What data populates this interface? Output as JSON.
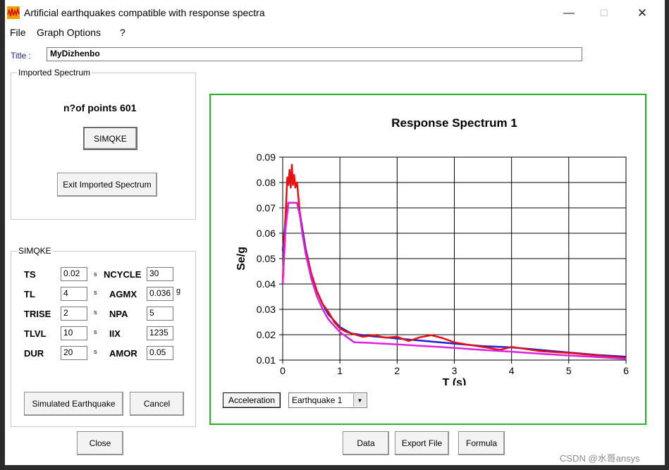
{
  "window": {
    "title": "Artificial earthquakes compatible with response spectra",
    "minimize": "—",
    "maximize": "☐",
    "close": "✕"
  },
  "menu": [
    "File",
    "Graph Options",
    "?"
  ],
  "title_field": {
    "label": "Title :",
    "value": "MyDizhenbo"
  },
  "imported": {
    "caption": "Imported Spectrum",
    "points_text": "n?of points 601",
    "simqke_button": "SIMQKE",
    "exit_button": "Exit Imported Spectrum"
  },
  "simqke": {
    "caption": "SIMQKE",
    "left": [
      {
        "label": "TS",
        "value": "0.02",
        "unit": "s"
      },
      {
        "label": "TL",
        "value": "4",
        "unit": "s"
      },
      {
        "label": "TRISE",
        "value": "2",
        "unit": "s"
      },
      {
        "label": "TLVL",
        "value": "10",
        "unit": "s"
      },
      {
        "label": "DUR",
        "value": "20",
        "unit": "s"
      }
    ],
    "right": [
      {
        "label": "NCYCLE",
        "value": "30",
        "unit": ""
      },
      {
        "label": "AGMX",
        "value": "0.036",
        "unit": "g"
      },
      {
        "label": "NPA",
        "value": "5",
        "unit": ""
      },
      {
        "label": "IIX",
        "value": "1235",
        "unit": ""
      },
      {
        "label": "AMOR",
        "value": "0.05",
        "unit": ""
      }
    ],
    "simulated_button": "Simulated Earthquake",
    "cancel_button": "Cancel"
  },
  "buttons": {
    "close": "Close",
    "data": "Data",
    "export": "Export File",
    "formula": "Formula",
    "acceleration": "Acceleration"
  },
  "earthquake_select": {
    "selected": "Earthquake 1"
  },
  "watermark": "CSDN @水哥ansys",
  "colors": {
    "frame": "#22b422",
    "series_target": "#2020d0",
    "series_simulated": "#e81010",
    "series_envelope": "#e020e0"
  },
  "chart_data": {
    "type": "line",
    "title": "Response Spectrum 1",
    "xlabel": "T (s)",
    "ylabel": "Se/g",
    "xlim": [
      0,
      6
    ],
    "ylim": [
      0.01,
      0.09
    ],
    "xticks": [
      "0",
      "1",
      "2",
      "3",
      "4",
      "5",
      "6"
    ],
    "yticks": [
      "0.01",
      "0.02",
      "0.03",
      "0.04",
      "0.05",
      "0.06",
      "0.07",
      "0.08",
      "0.09"
    ],
    "grid": true,
    "series": [
      {
        "color": "#2020d0",
        "x": [
          0,
          0.05,
          0.1,
          0.15,
          0.2,
          0.25,
          0.3,
          0.35,
          0.4,
          0.5,
          0.6,
          0.7,
          0.8,
          1.0,
          1.2,
          1.5,
          2.0,
          2.5,
          3.0,
          3.5,
          4.0,
          4.5,
          5.0,
          5.5,
          6.0
        ],
        "y": [
          0.053,
          0.066,
          0.072,
          0.072,
          0.072,
          0.072,
          0.068,
          0.061,
          0.054,
          0.044,
          0.037,
          0.032,
          0.028,
          0.023,
          0.0205,
          0.0195,
          0.0185,
          0.0175,
          0.0165,
          0.0155,
          0.015,
          0.014,
          0.013,
          0.012,
          0.0113
        ]
      },
      {
        "color": "#e81010",
        "x": [
          0,
          0.03,
          0.06,
          0.08,
          0.1,
          0.12,
          0.14,
          0.16,
          0.18,
          0.2,
          0.22,
          0.25,
          0.28,
          0.3,
          0.35,
          0.4,
          0.5,
          0.6,
          0.7,
          0.8,
          0.9,
          1.0,
          1.1,
          1.2,
          1.4,
          1.6,
          1.8,
          2.0,
          2.2,
          2.4,
          2.6,
          2.8,
          3.0,
          3.2,
          3.4,
          3.6,
          3.8,
          4.0,
          4.5,
          5.0,
          5.5,
          6.0
        ],
        "y": [
          0.041,
          0.058,
          0.072,
          0.082,
          0.079,
          0.085,
          0.078,
          0.087,
          0.079,
          0.083,
          0.078,
          0.08,
          0.073,
          0.068,
          0.059,
          0.053,
          0.044,
          0.037,
          0.032,
          0.029,
          0.025,
          0.0225,
          0.0212,
          0.0205,
          0.0192,
          0.0198,
          0.0188,
          0.0192,
          0.0175,
          0.019,
          0.0198,
          0.0186,
          0.017,
          0.0162,
          0.0155,
          0.0148,
          0.014,
          0.0152,
          0.0135,
          0.0128,
          0.0118,
          0.0108
        ]
      },
      {
        "color": "#e020e0",
        "x": [
          0,
          0.05,
          0.1,
          0.15,
          0.2,
          0.25,
          0.3,
          0.35,
          0.4,
          0.5,
          0.6,
          0.7,
          0.8,
          1.0,
          1.25,
          1.5,
          2.0,
          2.5,
          3.0,
          3.5,
          4.0,
          4.5,
          5.0,
          5.5,
          6.0
        ],
        "y": [
          0.04,
          0.062,
          0.072,
          0.072,
          0.072,
          0.072,
          0.067,
          0.059,
          0.052,
          0.042,
          0.035,
          0.03,
          0.026,
          0.021,
          0.017,
          0.0168,
          0.0162,
          0.0155,
          0.0148,
          0.014,
          0.0133,
          0.0125,
          0.0118,
          0.0112,
          0.0105
        ]
      }
    ]
  }
}
